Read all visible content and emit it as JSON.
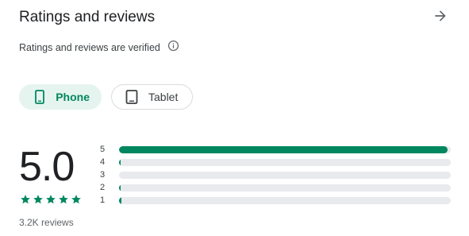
{
  "header": {
    "title": "Ratings and reviews",
    "arrow_icon": "arrow-forward-icon"
  },
  "verified": {
    "text": "Ratings and reviews are verified",
    "info_icon": "info-icon"
  },
  "device_chips": [
    {
      "label": "Phone",
      "icon": "phone-icon",
      "selected": true
    },
    {
      "label": "Tablet",
      "icon": "tablet-icon",
      "selected": false
    }
  ],
  "rating": {
    "score": "5.0",
    "stars": 5,
    "reviews_count": "3.2K reviews"
  },
  "histogram": [
    {
      "label": "5",
      "fraction": 0.99
    },
    {
      "label": "4",
      "fraction": 0.004
    },
    {
      "label": "3",
      "fraction": 0
    },
    {
      "label": "2",
      "fraction": 0.004
    },
    {
      "label": "1",
      "fraction": 0.006
    }
  ],
  "colors": {
    "accent": "#01875f",
    "chip_selected_bg": "#e6f4ef",
    "track": "#e8eaed",
    "text_primary": "#202124",
    "text_secondary": "#5f6368"
  }
}
